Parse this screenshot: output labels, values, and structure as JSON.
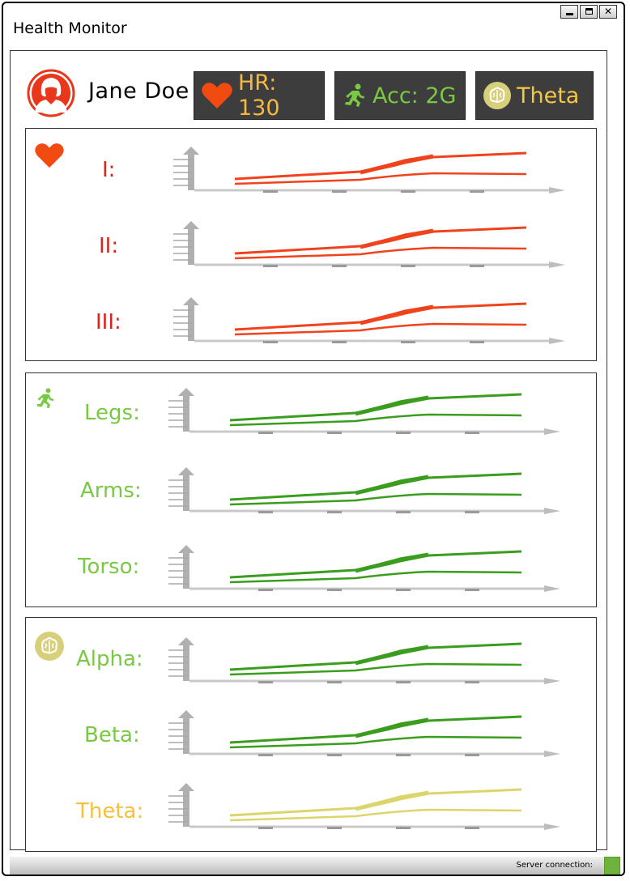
{
  "window": {
    "title": "Health Monitor"
  },
  "user": {
    "name": "Jane Doe"
  },
  "metrics": {
    "hr": {
      "label": "HR: 130",
      "color": "#f5b942",
      "icon": "heart-icon"
    },
    "acc": {
      "label": "Acc: 2G",
      "color": "#7ac943",
      "icon": "running-figure-icon"
    },
    "brain": {
      "label": "Theta",
      "color": "#f5c842",
      "icon": "brain-icon"
    }
  },
  "panels": {
    "heart": {
      "icon": "heart-icon",
      "color": "#e8371b",
      "rows": [
        {
          "label": "I:"
        },
        {
          "label": "II:"
        },
        {
          "label": "III:"
        }
      ]
    },
    "motion": {
      "icon": "running-figure-icon",
      "color": "#7ac943",
      "rows": [
        {
          "label": "Legs:"
        },
        {
          "label": "Arms:"
        },
        {
          "label": "Torso:"
        }
      ]
    },
    "brain": {
      "icon": "brain-icon",
      "color": "#7ac943",
      "rows": [
        {
          "label": "Alpha:"
        },
        {
          "label": "Beta:"
        },
        {
          "label": "Theta:"
        }
      ]
    }
  },
  "status": {
    "label": "Server connection:",
    "indicator_color": "#70b33c"
  }
}
